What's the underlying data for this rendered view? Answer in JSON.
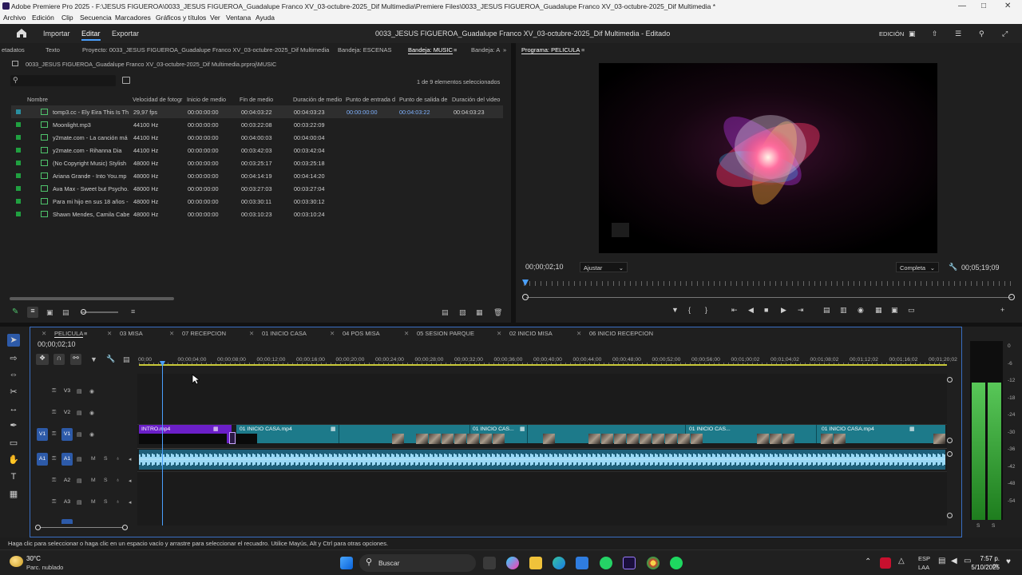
{
  "window": {
    "title": "Adobe Premiere Pro 2025 - F:\\JESUS FIGUEROA\\0033_JESUS FIGUEROA_Guadalupe Franco XV_03-octubre-2025_Dif Multimedia\\Premiere Files\\0033_JESUS FIGUEROA_Guadalupe Franco XV_03-octubre-2025_Dif Multimedia *"
  },
  "menu": [
    "Archivo",
    "Edición",
    "Clip",
    "Secuencia",
    "Marcadores",
    "Gráficos y títulos",
    "Ver",
    "Ventana",
    "Ayuda"
  ],
  "header": {
    "nav": [
      "Importar",
      "Editar",
      "Exportar"
    ],
    "project_title": "0033_JESUS FIGUEROA_Guadalupe Franco XV_03-octubre-2025_Dif Multimedia - Editado",
    "workspace": "EDICIÓN"
  },
  "project_panel": {
    "tabs": [
      "etadatos",
      "Texto",
      "Proyecto: 0033_JESUS FIGUEROA_Guadalupe Franco XV_03-octubre-2025_Dif Multimedia",
      "Bandeja: ESCENAS",
      "Bandeja: MUSIC",
      "Bandeja: A"
    ],
    "path": "0033_JESUS FIGUEROA_Guadalupe Franco XV_03-octubre-2025_Dif Multimedia.prproj\\MUSIC",
    "selection_info": "1 de 9 elementos seleccionados",
    "columns": [
      "Nombre",
      "Velocidad de fotogr",
      "Inicio de medio",
      "Fin de medio",
      "Duración de medio",
      "Punto de entrada d",
      "Punto de salida de",
      "Duración del video"
    ],
    "rows": [
      {
        "name": "tomp3.cc - Ely Eira  This Is Th",
        "rate": "29,97 fps",
        "start": "00:00:00:00",
        "end": "00:04:03:22",
        "duration": "00:04:03:23",
        "in": "00:00:00:00",
        "out": "00:04:03:22",
        "video_dur": "00:04:03:23"
      },
      {
        "name": "Moonlight.mp3",
        "rate": "44100 Hz",
        "start": "00:00:00:00",
        "end": "00:03:22:08",
        "duration": "00:03:22:09",
        "in": "",
        "out": "",
        "video_dur": ""
      },
      {
        "name": "y2mate.com - La canción má",
        "rate": "44100 Hz",
        "start": "00:00:00:00",
        "end": "00:04:00:03",
        "duration": "00:04:00:04",
        "in": "",
        "out": "",
        "video_dur": ""
      },
      {
        "name": "y2mate.com - Rihanna  Dia",
        "rate": "44100 Hz",
        "start": "00:00:00:00",
        "end": "00:03:42:03",
        "duration": "00:03:42:04",
        "in": "",
        "out": "",
        "video_dur": ""
      },
      {
        "name": "(No Copyright Music) Stylish",
        "rate": "48000 Hz",
        "start": "00:00:00:00",
        "end": "00:03:25:17",
        "duration": "00:03:25:18",
        "in": "",
        "out": "",
        "video_dur": ""
      },
      {
        "name": "Ariana Grande - Into You.mp",
        "rate": "48000 Hz",
        "start": "00:00:00:00",
        "end": "00:04:14:19",
        "duration": "00:04:14:20",
        "in": "",
        "out": "",
        "video_dur": ""
      },
      {
        "name": "Ava Max - Sweet but Psycho.",
        "rate": "48000 Hz",
        "start": "00:00:00:00",
        "end": "00:03:27:03",
        "duration": "00:03:27:04",
        "in": "",
        "out": "",
        "video_dur": ""
      },
      {
        "name": "Para mi hijo en sus 18 años -",
        "rate": "48000 Hz",
        "start": "00:00:00:00",
        "end": "00:03:30:11",
        "duration": "00:03:30:12",
        "in": "",
        "out": "",
        "video_dur": ""
      },
      {
        "name": "Shawn Mendes, Camila Cabe",
        "rate": "48000 Hz",
        "start": "00:00:00:00",
        "end": "00:03:10:23",
        "duration": "00:03:10:24",
        "in": "",
        "out": "",
        "video_dur": ""
      }
    ]
  },
  "program_monitor": {
    "tab": "Programa: PELICULA",
    "timecode": "00;00;02;10",
    "fit": "Ajustar",
    "quality": "Completa",
    "duration": "00;05;19;09"
  },
  "timeline": {
    "tabs": [
      "PELICULA",
      "03 MISA",
      "07 RECEPCION",
      "01 INICIO CASA",
      "04 POS MISA",
      "05 SESION PARQUE",
      "02 INICIO MISA",
      "06 INICIO RECEPCION"
    ],
    "timecode": "00;00;02;10",
    "ruler": [
      "00;00",
      "00;00;04;00",
      "00;00;08;00",
      "00;00;12;00",
      "00;00;16;00",
      "00;00;20;00",
      "00;00;24;00",
      "00;00;28;00",
      "00;00;32;00",
      "00;00;36;00",
      "00;00;40;00",
      "00;00;44;00",
      "00;00;48;00",
      "00;00;52;00",
      "00;00;56;00",
      "00;01;00;02",
      "00;01;04;02",
      "00;01;08;02",
      "00;01;12;02",
      "00;01;16;02",
      "00;01;20;02"
    ],
    "tracks": {
      "v3": "V3",
      "v2": "V2",
      "v1": "V1",
      "a1": "A1",
      "a2": "A2",
      "a3": "A3",
      "m": "M",
      "s": "S"
    },
    "clips": [
      "INTRO.mp4",
      "01 INICIO CASA.mp4",
      "01 INICIO CAS...",
      "01 INICIO CAS...",
      "01 INICIO CASA.mp4"
    ],
    "meter_labels": [
      "0",
      "-6",
      "-12",
      "-18",
      "-24",
      "-30",
      "-36",
      "-42",
      "-48",
      "-54"
    ],
    "meter_footer": [
      "S",
      "S"
    ]
  },
  "status": "Haga clic para seleccionar o haga clic en un espacio vacío y arrastre para seleccionar el recuadro. Utilice Mayús, Alt y Ctrl para otras opciones.",
  "taskbar": {
    "weather_temp": "30°C",
    "weather_desc": "Parc. nublado",
    "search": "Buscar",
    "lang1": "ESP",
    "lang2": "LAA",
    "time": "7:57 p. m.",
    "date": "5/10/2025"
  },
  "colors": {
    "accent": "#4aa0ff",
    "clip_video": "#1d7a8a",
    "clip_intro": "#7a1fd0",
    "audio": "#8ed0ef",
    "label_green": "#20a040"
  }
}
